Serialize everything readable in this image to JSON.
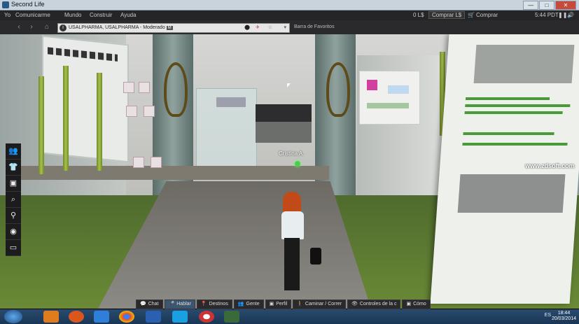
{
  "window": {
    "title": "Second Life",
    "minimize": "—",
    "maximize": "□",
    "close": "✕"
  },
  "menu": {
    "items": [
      "Yo",
      "Comunicarme",
      "Mundo",
      "Construir",
      "Ayuda"
    ],
    "balance": "0 L$",
    "buy_lindens": "Comprar L$",
    "buy": "Comprar",
    "time": "5:44 PDT"
  },
  "navbar": {
    "location": "USALPHARMA, USALPHARMA - Moderado",
    "rating_badge": "M",
    "favorites": "Barra de Favoritos"
  },
  "scene": {
    "avatar_name": "Cristina A.",
    "watermark": "www.zdsoft.com"
  },
  "side_toolbar": {
    "icons": [
      "people-icon",
      "shirt-icon",
      "camera-snapshot-icon",
      "search-icon",
      "map-pin-icon",
      "globe-icon",
      "camera-icon"
    ]
  },
  "bottom_toolbar": {
    "chat": "Chat",
    "speak": "Hablar",
    "destinations": "Destinos",
    "people": "Gente",
    "profile": "Perfil",
    "walk_run": "Caminar / Correr",
    "camera_controls": "Controles de la c",
    "how_to": "Cómo"
  },
  "taskbar": {
    "language": "ES",
    "clock_time": "18:44",
    "clock_date": "20/03/2014",
    "apps": [
      "media-player",
      "firefox",
      "dropbox",
      "chrome",
      "word",
      "skype",
      "record",
      "second-life"
    ]
  }
}
